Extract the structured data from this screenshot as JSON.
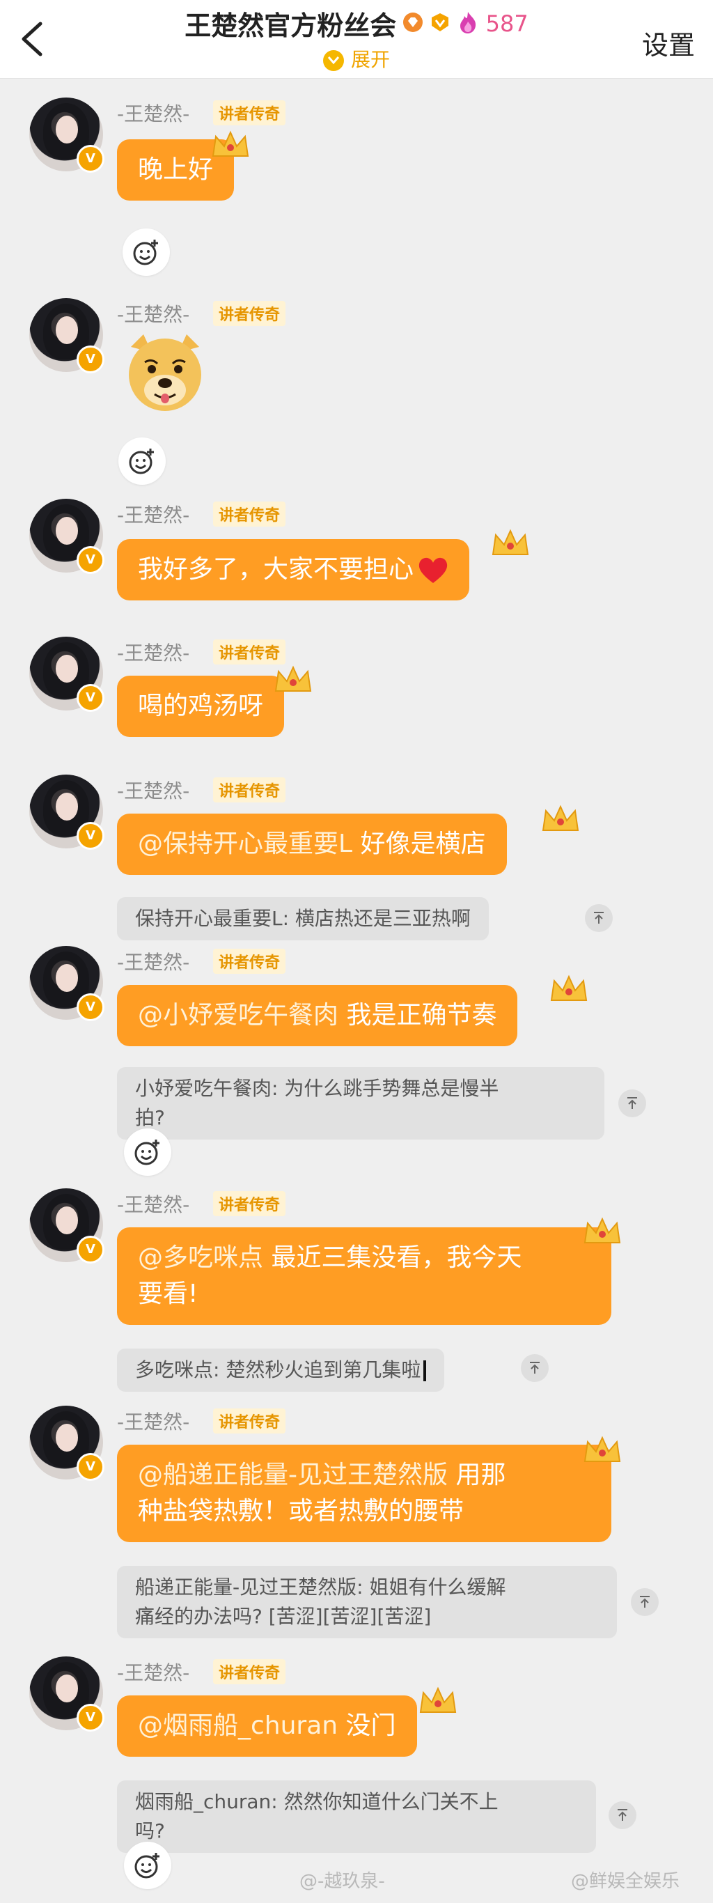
{
  "header": {
    "title": "王楚然官方粉丝会",
    "fans_count": "587",
    "expand_label": "展开",
    "settings_label": "设置"
  },
  "sender": {
    "name": "-王楚然-",
    "tag": "讲者传奇",
    "badge": "V"
  },
  "messages": [
    {
      "text": "晚上好"
    },
    {
      "type": "sticker",
      "icon": "doge-face-icon"
    },
    {
      "text": "我好多了，大家不要担心"
    },
    {
      "text": "喝的鸡汤呀"
    },
    {
      "mention": "@保持开心最重要L",
      "text": " 好像是横店",
      "quote": "保持开心最重要L: 横店热还是三亚热啊"
    },
    {
      "mention": "@小妤爱吃午餐肉",
      "text": " 我是正确节奏",
      "quote_line1": "小妤爱吃午餐肉: 为什么跳手势舞总是慢半",
      "quote_line2": "拍?"
    },
    {
      "mention": "@多吃咪点",
      "text_line1": " 最近三集没看，我今天",
      "text_line2": "要看!",
      "quote": "多吃咪点: 楚然秒火追到第几集啦"
    },
    {
      "mention": "@船递正能量-见过王楚然版",
      "text_line1": " 用那",
      "text_line2": "种盐袋热敷！或者热敷的腰带",
      "quote_line1": "船递正能量-见过王楚然版: 姐姐有什么缓解",
      "quote_line2": "痛经的办法吗? [苦涩][苦涩][苦涩]"
    },
    {
      "mention": "@烟雨船_churan",
      "text": " 没门",
      "quote_line1": "烟雨船_churan: 然然你知道什么门关不上",
      "quote_line2": "吗?"
    }
  ],
  "watermarks": [
    "@-越玖泉-",
    "@鲜娱全娱乐"
  ],
  "colors": {
    "bubble": "#ff9d23",
    "accent": "#f5a300",
    "fans_count": "#e8548a"
  }
}
